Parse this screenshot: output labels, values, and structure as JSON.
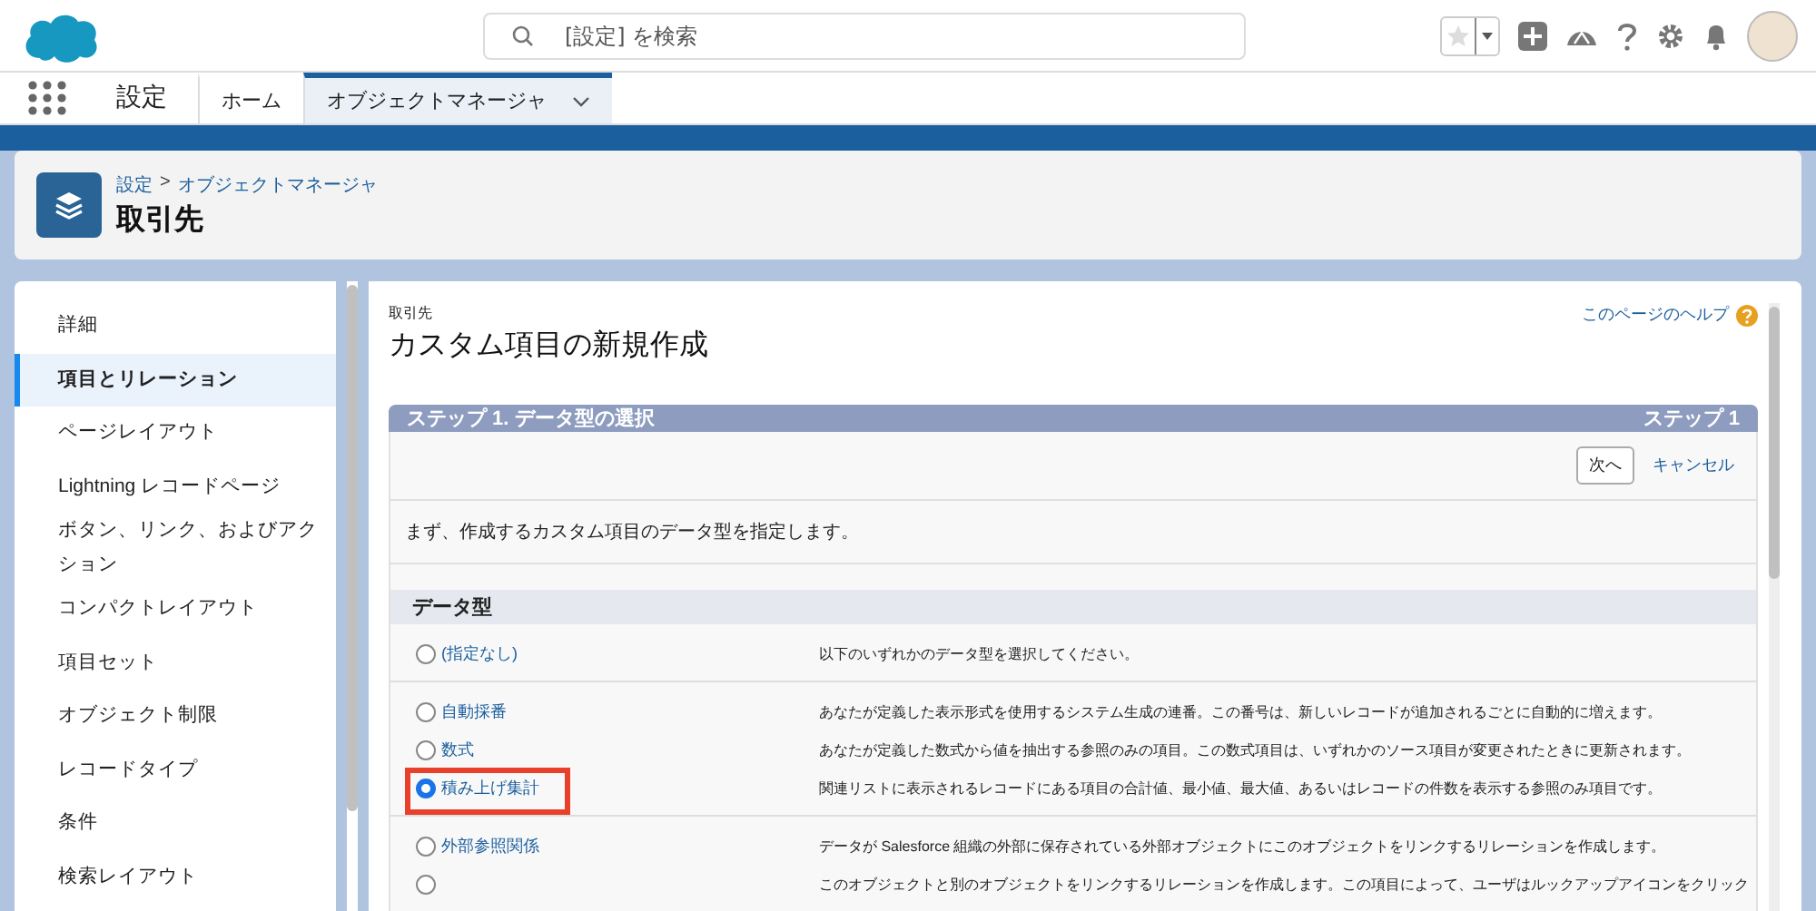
{
  "header": {
    "search": {
      "placeholder": "[設定] を検索"
    }
  },
  "nav": {
    "app_name": "設定",
    "tabs": [
      {
        "label": "ホーム",
        "selected": false,
        "menu": false
      },
      {
        "label": "オブジェクトマネージャ",
        "selected": true,
        "menu": true
      }
    ]
  },
  "page_header": {
    "breadcrumb": [
      {
        "label": "設定"
      },
      {
        "label": "オブジェクトマネージャ"
      }
    ],
    "separator": ">",
    "title": "取引先"
  },
  "sidebar": {
    "items": [
      {
        "label": "詳細",
        "selected": false
      },
      {
        "label": "項目とリレーション",
        "selected": true
      },
      {
        "label": "ページレイアウト",
        "selected": false
      },
      {
        "label": "Lightning レコードページ",
        "selected": false
      },
      {
        "label": "ボタン、リンク、およびアクション",
        "selected": false
      },
      {
        "label": "コンパクトレイアウト",
        "selected": false
      },
      {
        "label": "項目セット",
        "selected": false
      },
      {
        "label": "オブジェクト制限",
        "selected": false
      },
      {
        "label": "レコードタイプ",
        "selected": false
      },
      {
        "label": "条件",
        "selected": false
      },
      {
        "label": "検索レイアウト",
        "selected": false
      }
    ]
  },
  "content": {
    "object": "取引先",
    "title": "カスタム項目の新規作成",
    "help_link": "このページのヘルプ",
    "step": {
      "title": "ステップ 1. データ型の選択",
      "counter": "ステップ 1"
    },
    "buttons": {
      "next": "次へ",
      "cancel": "キャンセル"
    },
    "instruction": "まず、作成するカスタム項目のデータ型を指定します。",
    "section": "データ型",
    "groups": [
      [
        {
          "label": "(指定なし)",
          "description": "以下のいずれかのデータ型を選択してください。",
          "selected": false,
          "highlighted": false
        }
      ],
      [
        {
          "label": "自動採番",
          "description": "あなたが定義した表示形式を使用するシステム生成の連番。この番号は、新しいレコードが追加されるごとに自動的に増えます。",
          "selected": false,
          "highlighted": false
        },
        {
          "label": "数式",
          "description": "あなたが定義した数式から値を抽出する参照のみの項目。この数式項目は、いずれかのソース項目が変更されたときに更新されます。",
          "selected": false,
          "highlighted": false
        },
        {
          "label": "積み上げ集計",
          "description": "関連リストに表示されるレコードにある項目の合計値、最小値、最大値、あるいはレコードの件数を表示する参照のみ項目です。",
          "selected": true,
          "highlighted": true
        }
      ],
      [
        {
          "label": "外部参照関係",
          "description": "データが Salesforce 組織の外部に保存されている外部オブジェクトにこのオブジェクトをリンクするリレーションを作成します。",
          "selected": false,
          "highlighted": false
        },
        {
          "description": "このオブジェクトと別のオブジェクトをリンクするリレーションを作成します。この項目によって、ユーザはルックアップアイコンをクリック",
          "selected": false,
          "highlighted": false
        }
      ]
    ]
  }
}
